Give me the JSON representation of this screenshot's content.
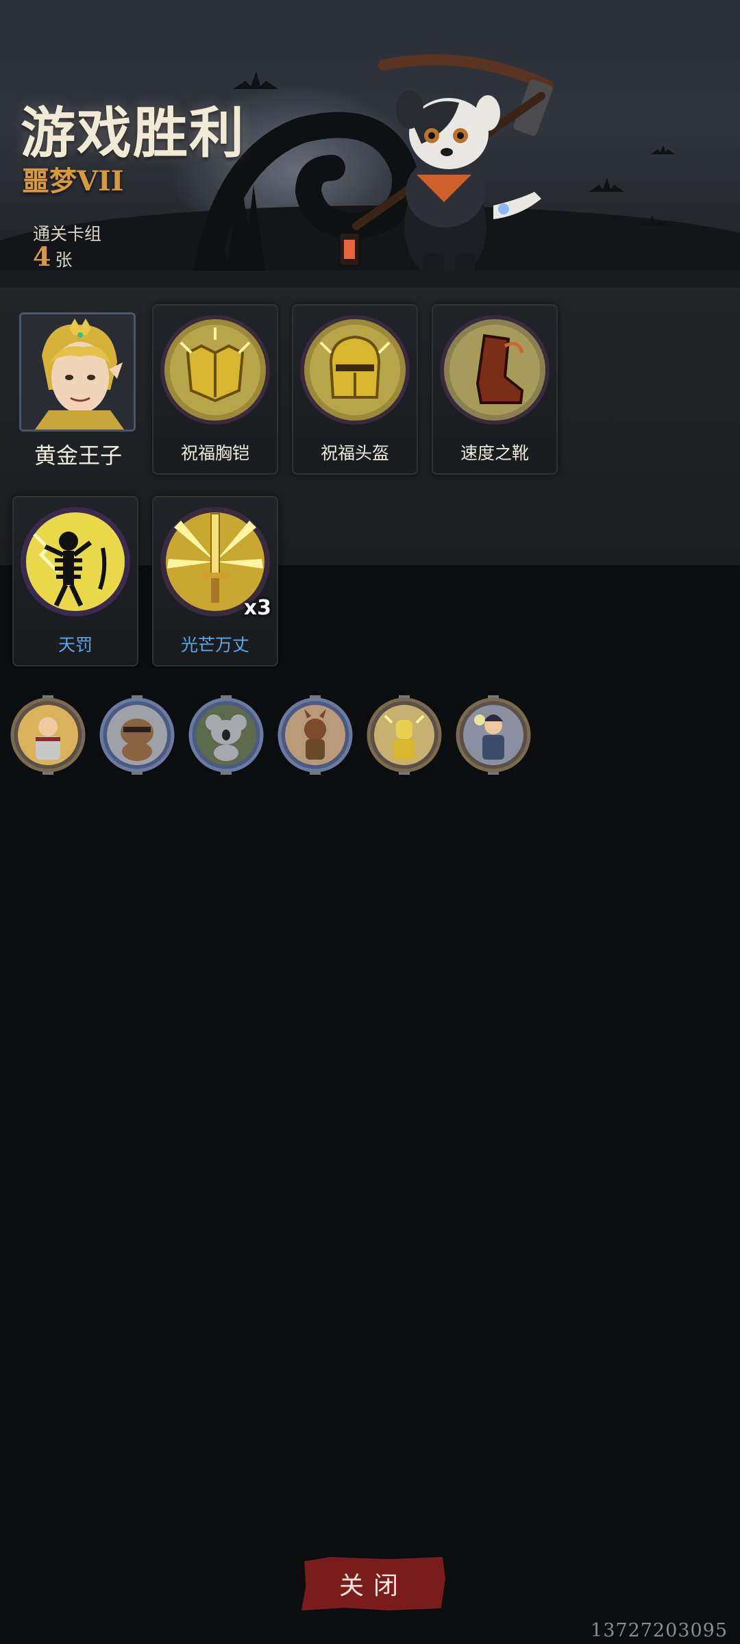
{
  "header": {
    "title": "游戏胜利",
    "difficulty": "噩梦VII",
    "deck_label": "通关卡组",
    "deck_count": "4",
    "deck_unit": "张"
  },
  "hero": {
    "name": "黄金王子"
  },
  "equipment": [
    {
      "label": "祝福胸铠",
      "icon": "chest-armor-icon"
    },
    {
      "label": "祝福头盔",
      "icon": "helmet-icon"
    },
    {
      "label": "速度之靴",
      "icon": "boots-icon"
    }
  ],
  "skills": [
    {
      "label": "天罚",
      "icon": "skeleton-lightning-icon"
    },
    {
      "label": "光芒万丈",
      "icon": "radiant-sword-icon",
      "count": "x3"
    }
  ],
  "companions": [
    "warrior-portrait-icon",
    "raccoon-portrait-icon",
    "koala-portrait-icon",
    "squirrel-portrait-icon",
    "golden-knight-portrait-icon",
    "mage-portrait-icon"
  ],
  "footer": {
    "close_label": "关闭",
    "watermark": "13727203095"
  },
  "colors": {
    "accent_gold": "#d89a3e",
    "skill_blue": "#5ca8e6",
    "close_red": "#7a1c1c"
  }
}
